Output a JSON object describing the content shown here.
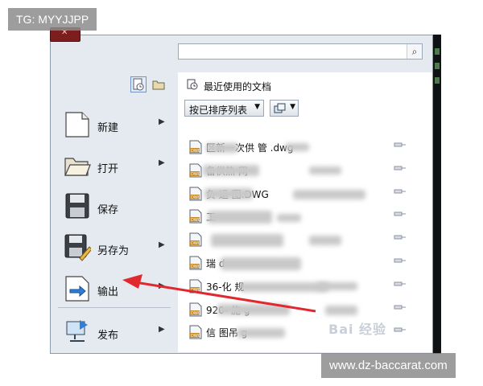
{
  "watermarks": {
    "top_left": "TG: MYYJJPP",
    "bottom_right": "www.dz-baccarat.com",
    "baidu": "Bai 经验"
  },
  "search": {
    "placeholder": ""
  },
  "recent": {
    "title": "最近使用的文档",
    "sort_label": "按已排序列表"
  },
  "menu": [
    {
      "label": "新建",
      "icon": "new-document-icon",
      "has_submenu": true
    },
    {
      "label": "打开",
      "icon": "open-folder-icon",
      "has_submenu": true
    },
    {
      "label": "保存",
      "icon": "save-icon",
      "has_submenu": false
    },
    {
      "label": "另存为",
      "icon": "save-as-icon",
      "has_submenu": true
    },
    {
      "label": "输出",
      "icon": "export-icon",
      "has_submenu": true
    },
    {
      "label": "发布",
      "icon": "publish-icon",
      "has_submenu": true
    }
  ],
  "files": [
    "区新一次供    管   .dwg",
    "     备供热   网   ",
    "    负        运     图.DWG",
    "        工       ",
    "    ",
    "瑞                 d",
    "36-化                    规",
    "920-           施            g",
    "信   图吊          g"
  ],
  "colors": {
    "arrow": "#e0282e",
    "accent": "#6e93c4"
  }
}
